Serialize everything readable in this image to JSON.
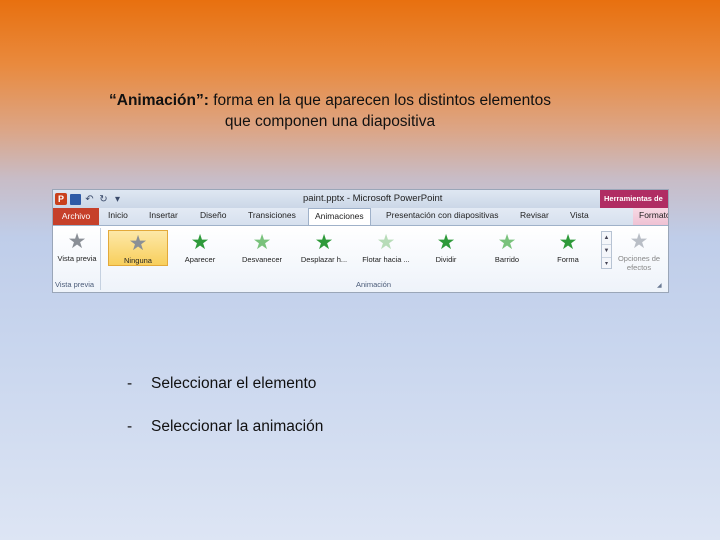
{
  "slide": {
    "title_lead": "“Animación”:",
    "title_rest": "forma en la que aparecen los distintos elementos que componen una diapositiva",
    "bullets": [
      "Seleccionar el elemento",
      "Seleccionar la animación"
    ],
    "bullet_marker": "-"
  },
  "window": {
    "title": "paint.pptx - Microsoft PowerPoint",
    "tools_tab": "Herramientas de"
  },
  "tabs": {
    "file": "Archivo",
    "home": "Inicio",
    "insert": "Insertar",
    "design": "Diseño",
    "transitions": "Transiciones",
    "animations": "Animaciones",
    "slideshow": "Presentación con diapositivas",
    "review": "Revisar",
    "view": "Vista",
    "format": "Formato"
  },
  "ribbon": {
    "preview_label": "Vista previa",
    "preview_group": "Vista previa",
    "animation_group": "Animación",
    "effects_label": "Opciones de efectos",
    "gallery": [
      {
        "label": "Ninguna",
        "icon": "star-gray-icon"
      },
      {
        "label": "Aparecer",
        "icon": "star-green-icon"
      },
      {
        "label": "Desvanecer",
        "icon": "star-light-green-icon"
      },
      {
        "label": "Desplazar h...",
        "icon": "star-green-icon"
      },
      {
        "label": "Flotar hacia ...",
        "icon": "star-light-green-icon"
      },
      {
        "label": "Dividir",
        "icon": "star-green-icon"
      },
      {
        "label": "Barrido",
        "icon": "star-light-green-icon"
      },
      {
        "label": "Forma",
        "icon": "star-green-icon"
      }
    ]
  },
  "colors": {
    "file_tab": "#c6402a",
    "tools_tab": "#b02d63",
    "selected_item": "#f8cf5c",
    "star_green": "#2e9a3a"
  }
}
